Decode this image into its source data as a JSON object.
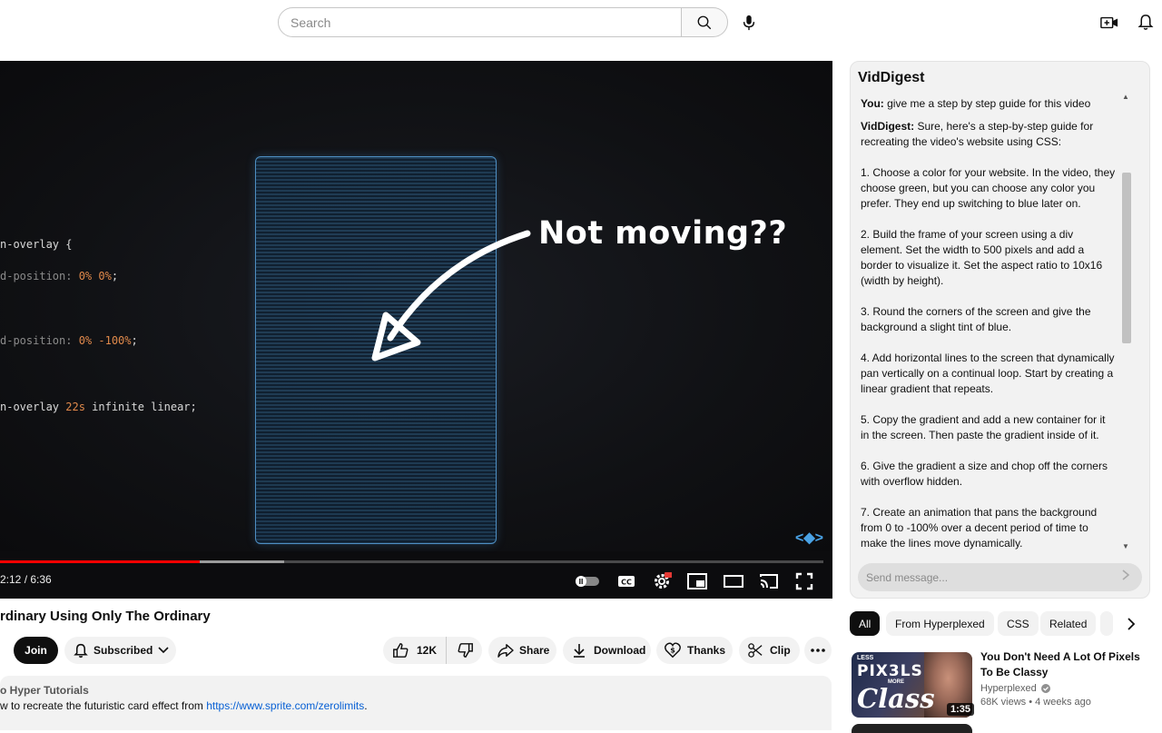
{
  "header": {
    "search_placeholder": "Search"
  },
  "player": {
    "code_lines": [
      {
        "pre": "n-overlay {",
        "nums": ""
      },
      {
        "pre": "d-position: ",
        "nums": "0% 0%",
        "post": ";"
      },
      {
        "pre": "d-position: ",
        "nums": "0% -100%",
        "post": ";"
      },
      {
        "pre": "n-overlay ",
        "nums": "22s",
        "post": " infinite linear;"
      }
    ],
    "overlay_text": "Not moving??",
    "time": "2:12 / 6:36",
    "progress_played": 0.243,
    "progress_buffered": 0.345
  },
  "video": {
    "title": "rdinary Using Only The Ordinary",
    "join_label": "Join",
    "subscribed_label": "Subscribed",
    "like_count": "12K",
    "share_label": "Share",
    "download_label": "Download",
    "thanks_label": "Thanks",
    "clip_label": "Clip",
    "channel_line": "o  Hyper Tutorials",
    "description_prefix": "w to recreate the futuristic card effect from ",
    "description_link": "https://www.sprite.com/zerolimits",
    "description_suffix": "."
  },
  "viddigest": {
    "title": "VidDigest",
    "user_label": "You:",
    "user_message": " give me a step by step guide for this video",
    "bot_label": "VidDigest:",
    "bot_intro": " Sure, here's a step-by-step guide for recreating the video's website using CSS:",
    "steps": [
      "1. Choose a color for your website. In the video, they choose green, but you can choose any color you prefer. They end up switching to blue later on.",
      "2. Build the frame of your screen using a div element. Set the width to 500 pixels and add a border to visualize it. Set the aspect ratio to 10x16 (width by height).",
      "3. Round the corners of the screen and give the background a slight tint of blue.",
      "4. Add horizontal lines to the screen that dynamically pan vertically on a continual loop. Start by creating a linear gradient that repeats.",
      "5. Copy the gradient and add a new container for it in the screen. Then paste the gradient inside of it.",
      "6. Give the gradient a size and chop off the corners with overflow hidden.",
      "7. Create an animation that pans the background from 0 to -100% over a decent period of time to make the lines move dynamically."
    ],
    "input_placeholder": "Send message..."
  },
  "chips": [
    "All",
    "From Hyperplexed",
    "CSS",
    "Related"
  ],
  "recommendation": {
    "thumb_small_top": "LESS",
    "thumb_big": "PIX3LS",
    "thumb_small_mid": "MORE",
    "thumb_script": "Class",
    "duration": "1:35",
    "title": "You Don't Need A Lot Of Pixels To Be Classy",
    "channel": "Hyperplexed",
    "meta": "68K views  •  4 weeks ago"
  }
}
